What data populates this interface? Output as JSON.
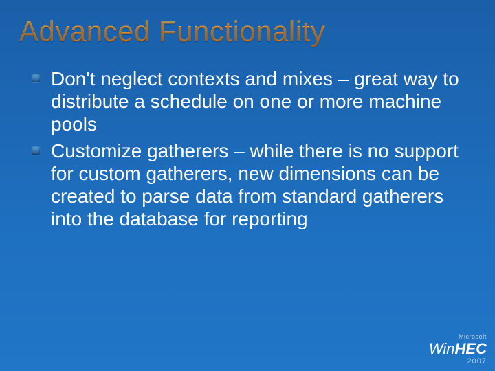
{
  "title": "Advanced Functionality",
  "bullets": [
    "Don't neglect contexts and mixes – great way to distribute a schedule on one or more machine pools",
    "Customize gatherers – while there is no support for custom gatherers, new dimensions can be created to parse data from standard gatherers into the database for reporting"
  ],
  "logo": {
    "vendor": "Microsoft",
    "brand_thin": "Win",
    "brand_bold": "HEC",
    "year": "2007"
  }
}
